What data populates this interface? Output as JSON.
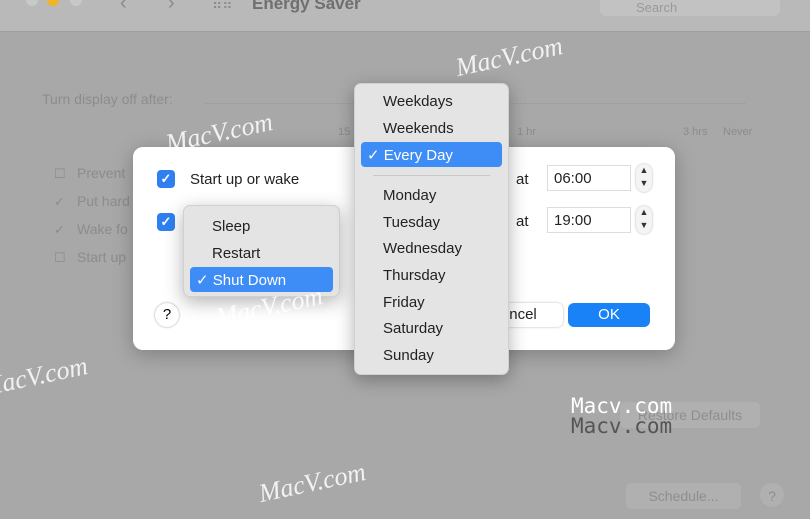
{
  "window": {
    "title": "Energy Saver",
    "search_placeholder": "Search"
  },
  "background": {
    "slider_label": "Turn display off after:",
    "slider_ticks": [
      "15",
      "1 hr",
      "3 hrs",
      "Never"
    ],
    "options": [
      "Prevent",
      "Put hard",
      "Wake fo",
      "Start up"
    ],
    "options_checked": [
      false,
      true,
      true,
      false
    ],
    "restore_defaults": "Restore Defaults",
    "schedule": "Schedule...",
    "help": "?"
  },
  "dialog": {
    "row1": {
      "checked": true,
      "label": "Start up or wake",
      "at": "at",
      "time": "06:00"
    },
    "row2": {
      "checked": true,
      "at": "at",
      "time": "19:00"
    },
    "help": "?",
    "cancel": "ncel",
    "ok": "OK"
  },
  "action_menu": {
    "items": [
      "Sleep",
      "Restart",
      "Shut Down"
    ],
    "selected": "Shut Down"
  },
  "day_menu": {
    "group1": [
      "Weekdays",
      "Weekends",
      "Every Day"
    ],
    "group2": [
      "Monday",
      "Tuesday",
      "Wednesday",
      "Thursday",
      "Friday",
      "Saturday",
      "Sunday"
    ],
    "selected": "Every Day",
    "check": "✓"
  },
  "watermark": {
    "logo": "MacV.com",
    "text": "Macv.com"
  },
  "colors": {
    "accent": "#2f7ff0",
    "highlight": "#3e8cf5"
  }
}
